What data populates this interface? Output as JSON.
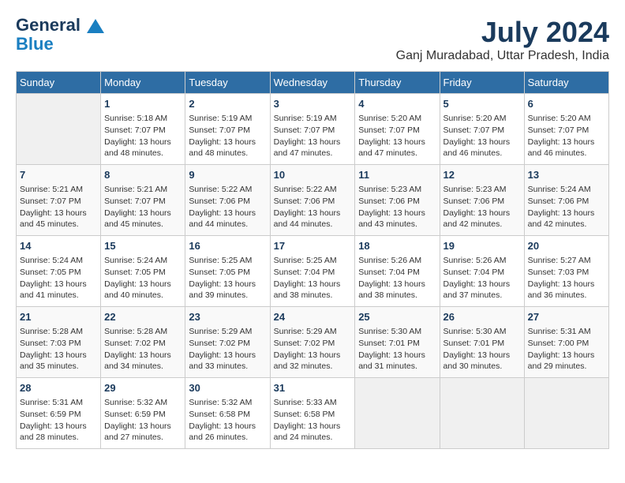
{
  "logo": {
    "general": "General",
    "blue": "Blue"
  },
  "title": "July 2024",
  "location": "Ganj Muradabad, Uttar Pradesh, India",
  "days_of_week": [
    "Sunday",
    "Monday",
    "Tuesday",
    "Wednesday",
    "Thursday",
    "Friday",
    "Saturday"
  ],
  "weeks": [
    [
      {
        "day": "",
        "info": ""
      },
      {
        "day": "1",
        "info": "Sunrise: 5:18 AM\nSunset: 7:07 PM\nDaylight: 13 hours\nand 48 minutes."
      },
      {
        "day": "2",
        "info": "Sunrise: 5:19 AM\nSunset: 7:07 PM\nDaylight: 13 hours\nand 48 minutes."
      },
      {
        "day": "3",
        "info": "Sunrise: 5:19 AM\nSunset: 7:07 PM\nDaylight: 13 hours\nand 47 minutes."
      },
      {
        "day": "4",
        "info": "Sunrise: 5:20 AM\nSunset: 7:07 PM\nDaylight: 13 hours\nand 47 minutes."
      },
      {
        "day": "5",
        "info": "Sunrise: 5:20 AM\nSunset: 7:07 PM\nDaylight: 13 hours\nand 46 minutes."
      },
      {
        "day": "6",
        "info": "Sunrise: 5:20 AM\nSunset: 7:07 PM\nDaylight: 13 hours\nand 46 minutes."
      }
    ],
    [
      {
        "day": "7",
        "info": "Sunrise: 5:21 AM\nSunset: 7:07 PM\nDaylight: 13 hours\nand 45 minutes."
      },
      {
        "day": "8",
        "info": "Sunrise: 5:21 AM\nSunset: 7:07 PM\nDaylight: 13 hours\nand 45 minutes."
      },
      {
        "day": "9",
        "info": "Sunrise: 5:22 AM\nSunset: 7:06 PM\nDaylight: 13 hours\nand 44 minutes."
      },
      {
        "day": "10",
        "info": "Sunrise: 5:22 AM\nSunset: 7:06 PM\nDaylight: 13 hours\nand 44 minutes."
      },
      {
        "day": "11",
        "info": "Sunrise: 5:23 AM\nSunset: 7:06 PM\nDaylight: 13 hours\nand 43 minutes."
      },
      {
        "day": "12",
        "info": "Sunrise: 5:23 AM\nSunset: 7:06 PM\nDaylight: 13 hours\nand 42 minutes."
      },
      {
        "day": "13",
        "info": "Sunrise: 5:24 AM\nSunset: 7:06 PM\nDaylight: 13 hours\nand 42 minutes."
      }
    ],
    [
      {
        "day": "14",
        "info": "Sunrise: 5:24 AM\nSunset: 7:05 PM\nDaylight: 13 hours\nand 41 minutes."
      },
      {
        "day": "15",
        "info": "Sunrise: 5:24 AM\nSunset: 7:05 PM\nDaylight: 13 hours\nand 40 minutes."
      },
      {
        "day": "16",
        "info": "Sunrise: 5:25 AM\nSunset: 7:05 PM\nDaylight: 13 hours\nand 39 minutes."
      },
      {
        "day": "17",
        "info": "Sunrise: 5:25 AM\nSunset: 7:04 PM\nDaylight: 13 hours\nand 38 minutes."
      },
      {
        "day": "18",
        "info": "Sunrise: 5:26 AM\nSunset: 7:04 PM\nDaylight: 13 hours\nand 38 minutes."
      },
      {
        "day": "19",
        "info": "Sunrise: 5:26 AM\nSunset: 7:04 PM\nDaylight: 13 hours\nand 37 minutes."
      },
      {
        "day": "20",
        "info": "Sunrise: 5:27 AM\nSunset: 7:03 PM\nDaylight: 13 hours\nand 36 minutes."
      }
    ],
    [
      {
        "day": "21",
        "info": "Sunrise: 5:28 AM\nSunset: 7:03 PM\nDaylight: 13 hours\nand 35 minutes."
      },
      {
        "day": "22",
        "info": "Sunrise: 5:28 AM\nSunset: 7:02 PM\nDaylight: 13 hours\nand 34 minutes."
      },
      {
        "day": "23",
        "info": "Sunrise: 5:29 AM\nSunset: 7:02 PM\nDaylight: 13 hours\nand 33 minutes."
      },
      {
        "day": "24",
        "info": "Sunrise: 5:29 AM\nSunset: 7:02 PM\nDaylight: 13 hours\nand 32 minutes."
      },
      {
        "day": "25",
        "info": "Sunrise: 5:30 AM\nSunset: 7:01 PM\nDaylight: 13 hours\nand 31 minutes."
      },
      {
        "day": "26",
        "info": "Sunrise: 5:30 AM\nSunset: 7:01 PM\nDaylight: 13 hours\nand 30 minutes."
      },
      {
        "day": "27",
        "info": "Sunrise: 5:31 AM\nSunset: 7:00 PM\nDaylight: 13 hours\nand 29 minutes."
      }
    ],
    [
      {
        "day": "28",
        "info": "Sunrise: 5:31 AM\nSunset: 6:59 PM\nDaylight: 13 hours\nand 28 minutes."
      },
      {
        "day": "29",
        "info": "Sunrise: 5:32 AM\nSunset: 6:59 PM\nDaylight: 13 hours\nand 27 minutes."
      },
      {
        "day": "30",
        "info": "Sunrise: 5:32 AM\nSunset: 6:58 PM\nDaylight: 13 hours\nand 26 minutes."
      },
      {
        "day": "31",
        "info": "Sunrise: 5:33 AM\nSunset: 6:58 PM\nDaylight: 13 hours\nand 24 minutes."
      },
      {
        "day": "",
        "info": ""
      },
      {
        "day": "",
        "info": ""
      },
      {
        "day": "",
        "info": ""
      }
    ]
  ]
}
